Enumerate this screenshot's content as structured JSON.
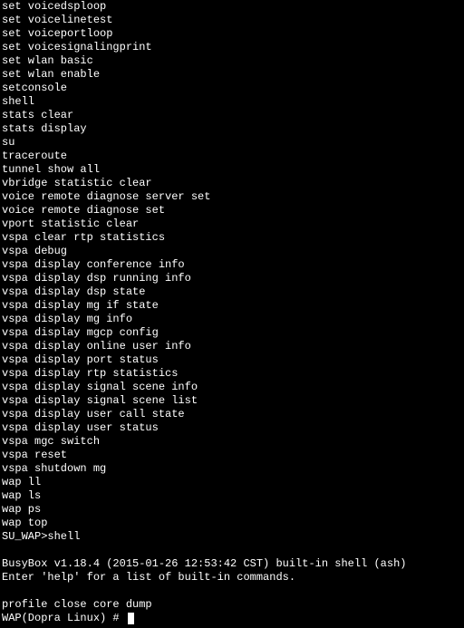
{
  "lines": [
    "set voicedsploop",
    "set voicelinetest",
    "set voiceportloop",
    "set voicesignalingprint",
    "set wlan basic",
    "set wlan enable",
    "setconsole",
    "shell",
    "stats clear",
    "stats display",
    "su",
    "traceroute",
    "tunnel show all",
    "vbridge statistic clear",
    "voice remote diagnose server set",
    "voice remote diagnose set",
    "vport statistic clear",
    "vspa clear rtp statistics",
    "vspa debug",
    "vspa display conference info",
    "vspa display dsp running info",
    "vspa display dsp state",
    "vspa display mg if state",
    "vspa display mg info",
    "vspa display mgcp config",
    "vspa display online user info",
    "vspa display port status",
    "vspa display rtp statistics",
    "vspa display signal scene info",
    "vspa display signal scene list",
    "vspa display user call state",
    "vspa display user status",
    "vspa mgc switch",
    "vspa reset",
    "vspa shutdown mg",
    "wap ll",
    "wap ls",
    "wap ps",
    "wap top"
  ],
  "shell_prompt_line": "SU_WAP>shell",
  "busybox_line": "BusyBox v1.18.4 (2015-01-26 12:53:42 CST) built-in shell (ash)",
  "help_line": "Enter 'help' for a list of built-in commands.",
  "profile_line": "profile close core dump",
  "final_prompt": "WAP(Dopra Linux) # "
}
